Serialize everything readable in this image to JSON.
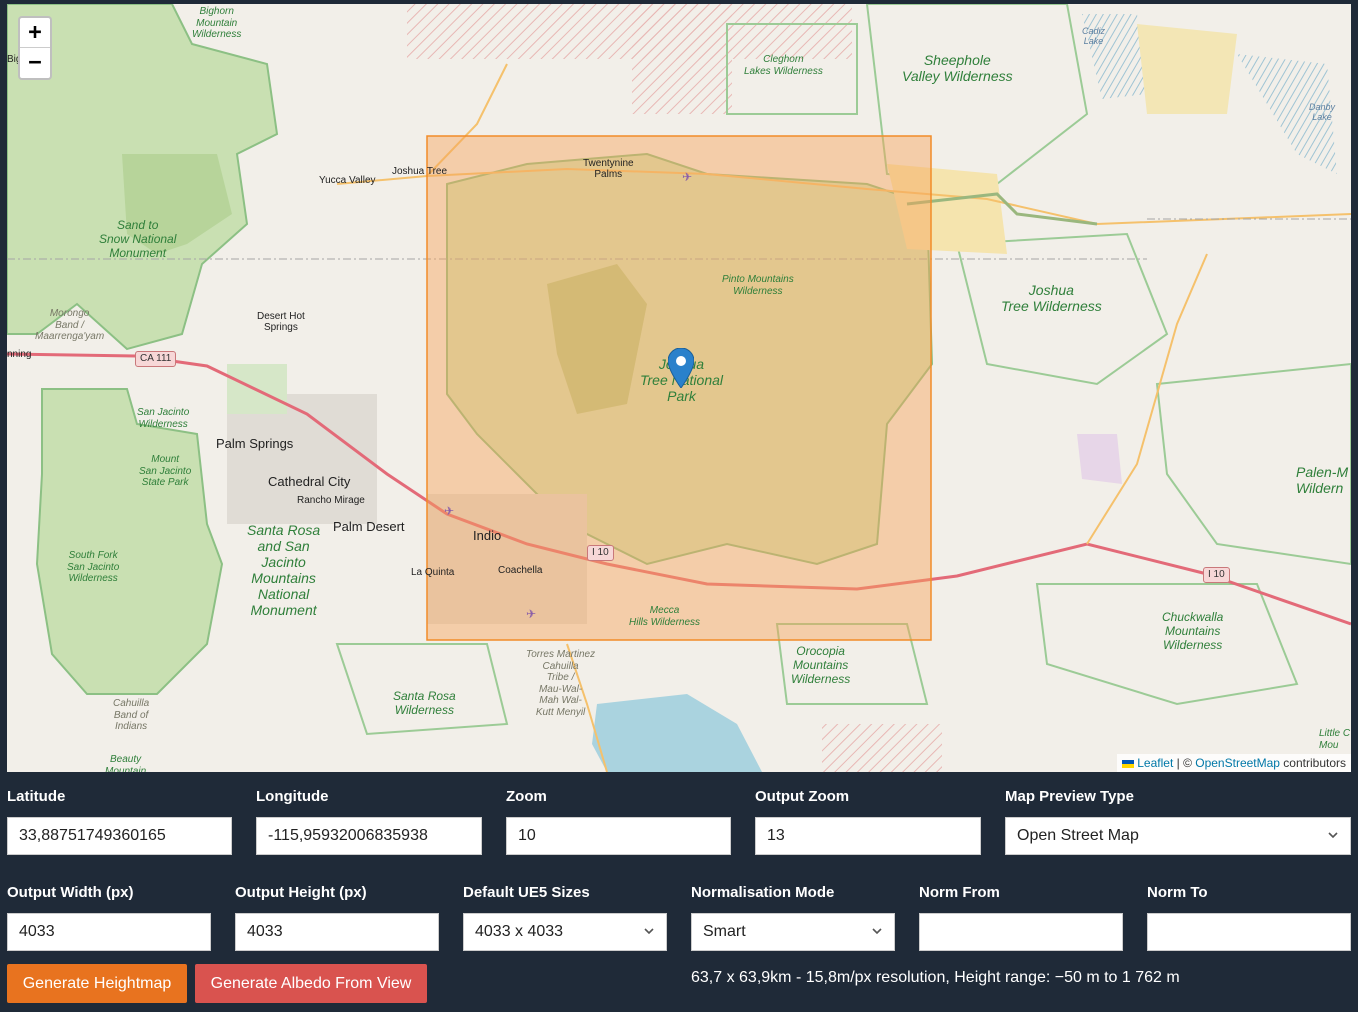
{
  "map": {
    "zoom_in": "+",
    "zoom_out": "−",
    "attribution": {
      "leaflet": "Leaflet",
      "separator": " | © ",
      "osm": "OpenStreetMap",
      "contributors": " contributors"
    },
    "labels": {
      "bighorn": "Bighorn\nMountain\nWilderness",
      "big_city": "Big  City",
      "cleghorn": "Cleghorn\nLakes Wilderness",
      "sheephole": "Sheephole\nValley Wilderness",
      "cadiz": "Cadiz\nLake",
      "danby": "Danby\nLake",
      "twentynine": "Twentynine\nPalms",
      "joshua_tree_town": "Joshua Tree",
      "yucca": "Yucca Valley",
      "sand_to_snow": "Sand to\nSnow National\nMonument",
      "pinto": "Pinto Mountains\nWilderness",
      "jt_wilderness": "Joshua\nTree Wilderness",
      "morongo": "Morongo\nBand /\nMaarrenga'yam",
      "desert_hot": "Desert Hot\nSprings",
      "ca111": "CA 111",
      "nning": "nning",
      "jtnp": "Joshua\nTree National\nPark",
      "san_jacinto_w": "San Jacinto\nWilderness",
      "palm_springs": "Palm Springs",
      "mount_sj": "Mount\nSan Jacinto\nState Park",
      "cathedral": "Cathedral City",
      "rancho": "Rancho Mirage",
      "palm_desert": "Palm Desert",
      "indio": "Indio",
      "santa_rosa_mon": "Santa Rosa\nand San\nJacinto\nMountains\nNational\nMonument",
      "south_fork": "South Fork\nSan Jacinto\nWilderness",
      "la_quinta": "La Quinta",
      "coachella": "Coachella",
      "i10_a": "I 10",
      "i10_b": "I 10",
      "palen": "Palen-M\nWildern",
      "mecca": "Mecca\nHills Wilderness",
      "chuckwalla": "Chuckwalla\nMountains\nWilderness",
      "torres": "Torres Martinez\nCahuilla\nTribe /\nMau-Wal-\nMah Wal-\nKutt Menyil",
      "orocopia": "Orocopia\nMountains\nWilderness",
      "santa_rosa_w": "Santa Rosa\nWilderness",
      "cahuilla": "Cahuilla\nBand of\nIndians",
      "beauty": "Beauty\nMountain",
      "little": "Little C\nMou"
    }
  },
  "form": {
    "latitude": {
      "label": "Latitude",
      "value": "33,88751749360165"
    },
    "longitude": {
      "label": "Longitude",
      "value": "-115,95932006835938"
    },
    "zoom": {
      "label": "Zoom",
      "value": "10"
    },
    "output_zoom": {
      "label": "Output Zoom",
      "value": "13"
    },
    "preview_type": {
      "label": "Map Preview Type",
      "value": "Open Street Map"
    },
    "output_width": {
      "label": "Output Width (px)",
      "value": "4033"
    },
    "output_height": {
      "label": "Output Height (px)",
      "value": "4033"
    },
    "ue5_sizes": {
      "label": "Default UE5 Sizes",
      "value": "4033 x 4033"
    },
    "norm_mode": {
      "label": "Normalisation Mode",
      "value": "Smart"
    },
    "norm_from": {
      "label": "Norm From",
      "value": ""
    },
    "norm_to": {
      "label": "Norm To",
      "value": ""
    }
  },
  "actions": {
    "generate_heightmap": "Generate Heightmap",
    "generate_albedo": "Generate Albedo From View"
  },
  "status": "63,7 x 63,9km - 15,8m/px resolution, Height range: −50 m to 1 762 m",
  "colors": {
    "page_bg": "#1f2a38",
    "map_bg": "#f2efe9",
    "selection_fill": "#f7a35c",
    "selection_stroke": "#f28c28",
    "park_green": "#c8e0b0",
    "park_border": "#7fb77a",
    "highway": "#e36a78",
    "primary_road": "#f5c16c",
    "heightmap_button": "#e8731f",
    "albedo_button": "#d9534f",
    "marker": "#2a81cb",
    "water": "#aad3df"
  }
}
